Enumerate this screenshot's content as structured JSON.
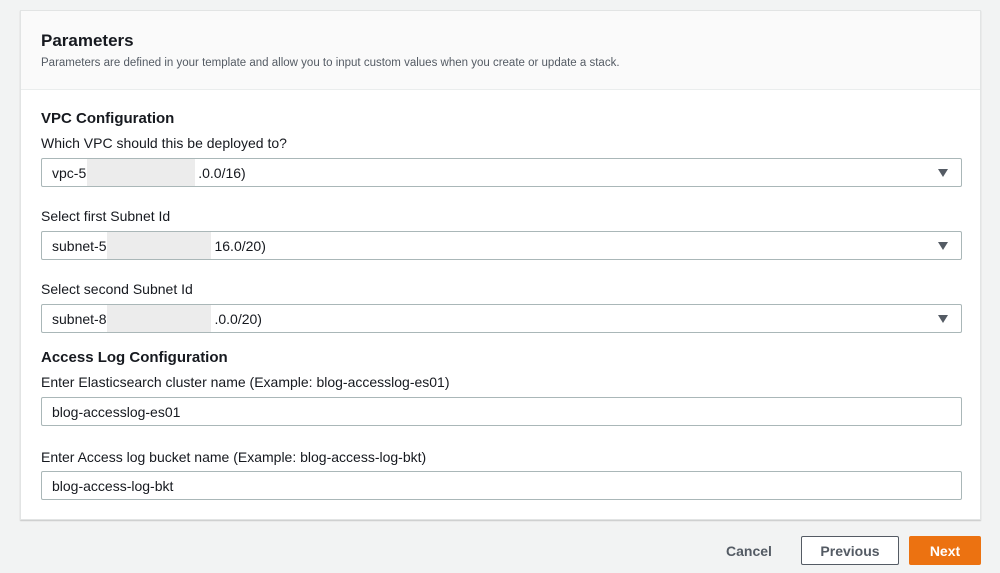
{
  "parameters": {
    "title": "Parameters",
    "description": "Parameters are defined in your template and allow you to input custom values when you create or update a stack."
  },
  "vpc_configuration": {
    "title": "VPC Configuration",
    "vpc": {
      "label": "Which VPC should this be deployed to?",
      "value_prefix": "vpc-5",
      "value_suffix": ".0.0/16)"
    },
    "first_subnet": {
      "label": "Select first Subnet Id",
      "value_prefix": "subnet-5",
      "value_suffix": "16.0/20)"
    },
    "second_subnet": {
      "label": "Select second Subnet Id",
      "value_prefix": "subnet-8",
      "value_suffix": ".0.0/20)"
    }
  },
  "access_log_configuration": {
    "title": "Access Log Configuration",
    "es_cluster": {
      "label": "Enter Elasticsearch cluster name (Example: blog-accesslog-es01)",
      "value": "blog-accesslog-es01"
    },
    "bucket": {
      "label": "Enter Access log bucket name (Example: blog-access-log-bkt)",
      "value": "blog-access-log-bkt"
    }
  },
  "footer": {
    "cancel_label": "Cancel",
    "previous_label": "Previous",
    "next_label": "Next"
  },
  "colors": {
    "primary_button": "#ec7211",
    "text": "#16191f",
    "secondary_text": "#545b64",
    "border": "#aab7b8"
  }
}
